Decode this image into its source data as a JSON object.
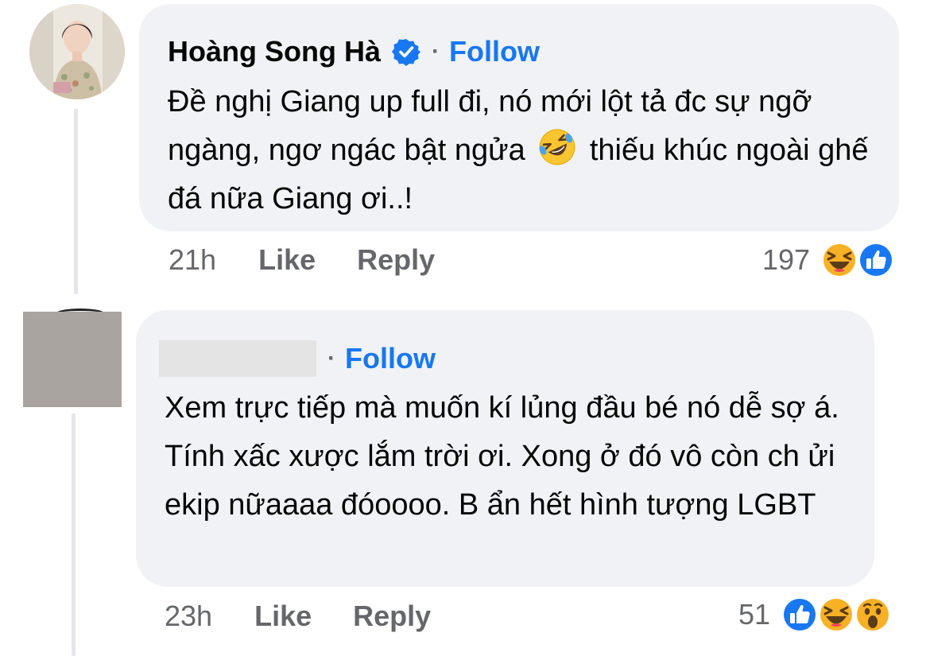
{
  "comments": [
    {
      "author": "Hoàng Song Hà",
      "verified": true,
      "follow_label": "Follow",
      "text_before_emoji": "Đề nghị Giang up full đi, nó mới lột tả đc sự ngỡ ngàng, ngơ ngác bật ngửa ",
      "text_after_emoji": " thiếu khúc ngoài ghế đá nữa Giang ơi..!",
      "inline_emoji": "rofl-emoji",
      "time": "21h",
      "like_label": "Like",
      "reply_label": "Reply",
      "reaction_count": "197",
      "reactions": [
        "haha",
        "like"
      ]
    },
    {
      "author": "",
      "verified": false,
      "follow_label": "Follow",
      "text": "Xem trực tiếp mà muốn kí lủng đầu bé nó dễ sợ á. Tính xấc xược lắm trời ơi. Xong ở đó vô còn ch ửi ekip nữaaaa đóoooo. B ẩn hết hình tượng LGBT",
      "time": "23h",
      "like_label": "Like",
      "reply_label": "Reply",
      "reaction_count": "51",
      "reactions": [
        "like",
        "haha",
        "wow"
      ]
    }
  ],
  "colors": {
    "bubble": "#f0f2f5",
    "follow": "#1877f2",
    "meta": "#65676b",
    "like_reaction": "#1877f2",
    "haha_reaction": "#f7b125"
  }
}
